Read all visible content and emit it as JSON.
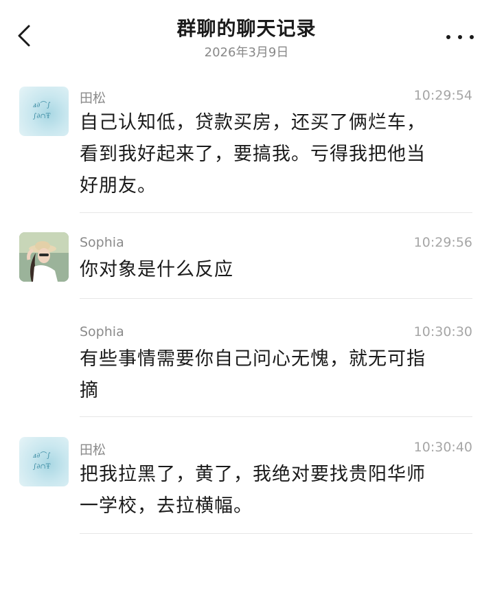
{
  "header": {
    "title": "群聊的聊天记录",
    "date": "2026年3月9日",
    "back_icon": "chevron-left-icon",
    "more_icon": "more-dots-icon"
  },
  "messages": [
    {
      "sender": "田松",
      "time": "10:29:54",
      "avatar": "tian-avatar",
      "lines": [
        "自己认知低，贷款买房，还买了俩烂车，",
        "看到我好起来了，要搞我。亏得我把他当",
        "好朋友。"
      ]
    },
    {
      "sender": "Sophia",
      "time": "10:29:56",
      "avatar": "sophia-avatar",
      "lines": [
        "你对象是什么反应"
      ]
    },
    {
      "sender": "Sophia",
      "time": "10:30:30",
      "avatar": "",
      "lines": [
        "有些事情需要你自己问心无愧，就无可指",
        "摘"
      ]
    },
    {
      "sender": "田松",
      "time": "10:30:40",
      "avatar": "tian-avatar",
      "lines": [
        "把我拉黑了，黄了，我绝对要找贵阳华师",
        "一学校，去拉横幅。"
      ]
    }
  ]
}
